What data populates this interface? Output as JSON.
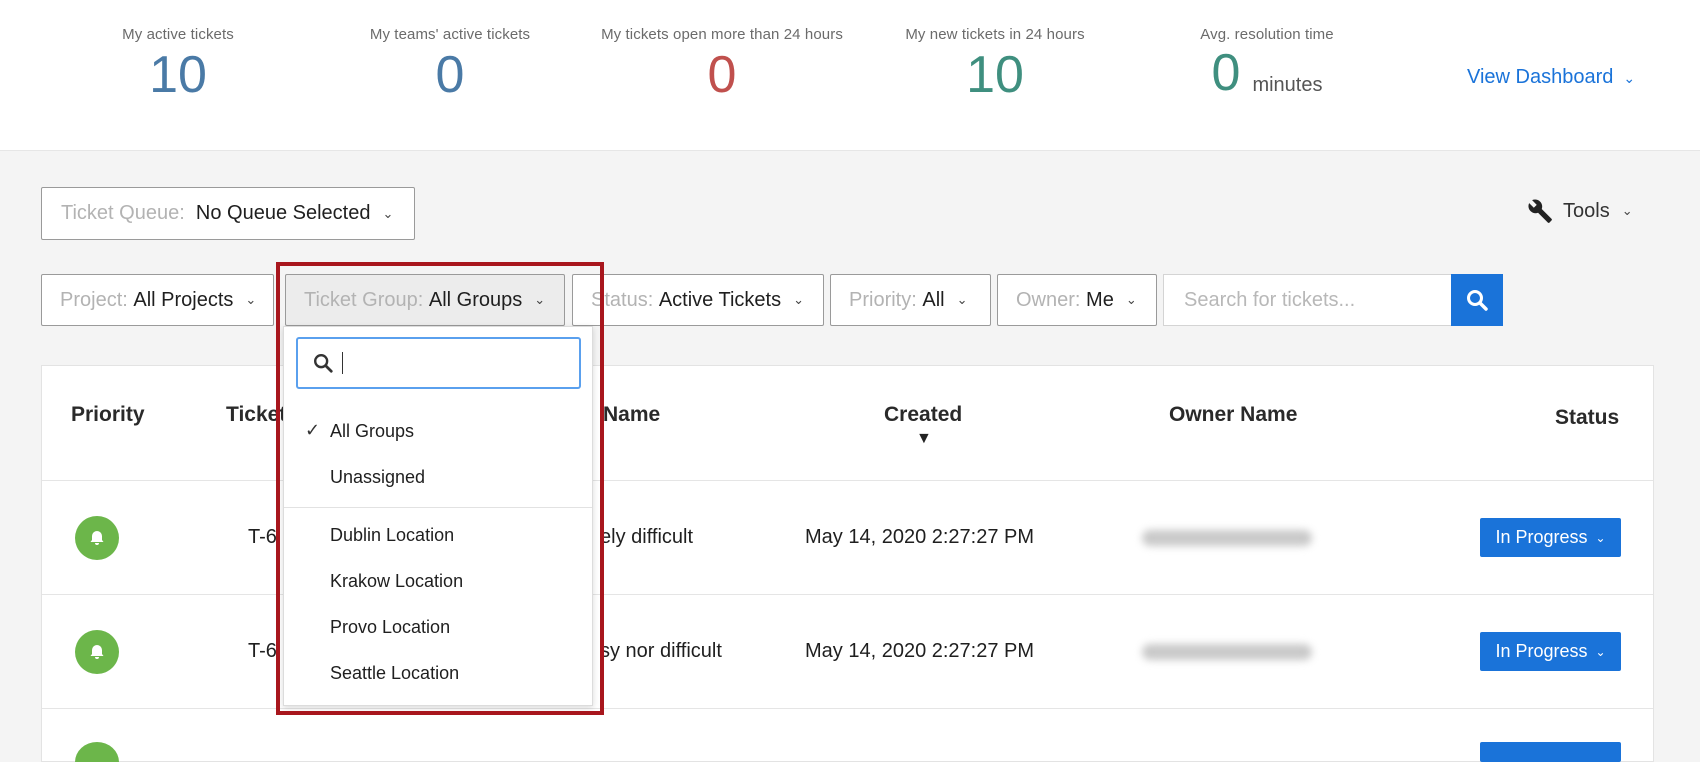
{
  "stats": [
    {
      "label": "My active tickets",
      "value": "10",
      "color": "#4a7aa6"
    },
    {
      "label": "My teams' active tickets",
      "value": "0",
      "color": "#4a7aa6"
    },
    {
      "label": "My tickets open more than 24 hours",
      "value": "0",
      "color": "#c0504d"
    },
    {
      "label": "My new tickets in 24 hours",
      "value": "10",
      "color": "#3f8f7f"
    },
    {
      "label": "Avg. resolution time",
      "value": "0",
      "unit": "minutes",
      "color": "#3f8f7f"
    }
  ],
  "view_dashboard": "View Dashboard",
  "queue": {
    "label": "Ticket Queue:",
    "value": "No Queue Selected"
  },
  "tools": "Tools",
  "filters": {
    "project": {
      "label": "Project:",
      "value": "All Projects"
    },
    "ticket_group": {
      "label": "Ticket Group:",
      "value": "All Groups"
    },
    "status": {
      "label": "Status:",
      "value": "Active Tickets"
    },
    "priority": {
      "label": "Priority:",
      "value": "All"
    },
    "owner": {
      "label": "Owner:",
      "value": "Me"
    }
  },
  "search": {
    "placeholder": "Search for tickets..."
  },
  "table": {
    "headers": {
      "priority": "Priority",
      "ticket": "Ticket",
      "name": "Name",
      "created": "Created",
      "owner": "Owner Name",
      "status": "Status"
    },
    "rows": [
      {
        "ticket": "T-6",
        "name": "ely difficult",
        "created": "May 14, 2020 2:27:27 PM",
        "status": "In Progress"
      },
      {
        "ticket": "T-6",
        "name": "sy nor difficult",
        "created": "May 14, 2020 2:27:27 PM",
        "status": "In Progress"
      }
    ]
  },
  "dropdown": {
    "search_value": "",
    "items_top": [
      "All Groups",
      "Unassigned"
    ],
    "items_locations": [
      "Dublin Location",
      "Krakow Location",
      "Provo Location",
      "Seattle Location"
    ],
    "selected": "All Groups"
  },
  "colors": {
    "accent": "#1a73d9",
    "priority_low": "#6cb64a",
    "highlight": "#a8161d"
  }
}
